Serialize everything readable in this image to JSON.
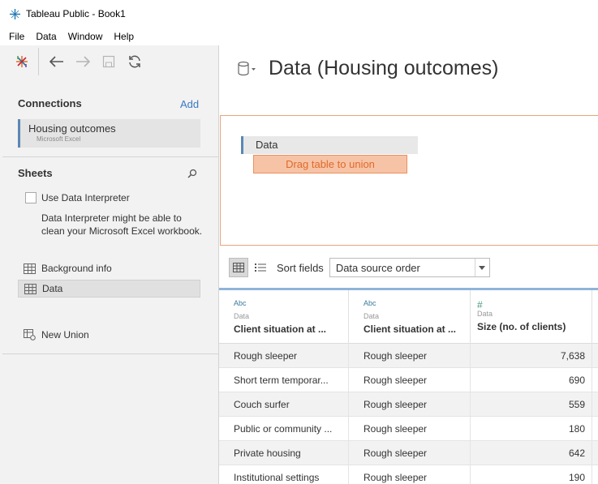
{
  "window": {
    "title": "Tableau Public - Book1"
  },
  "menu": [
    "File",
    "Data",
    "Window",
    "Help"
  ],
  "left": {
    "connections_title": "Connections",
    "add_label": "Add",
    "connection": {
      "name": "Housing outcomes",
      "type": "Microsoft Excel"
    },
    "sheets_title": "Sheets",
    "use_interpreter_label": "Use Data Interpreter",
    "interpreter_desc": "Data Interpreter might be able to clean your Microsoft Excel workbook.",
    "sheets": [
      {
        "label": "Background info",
        "selected": false
      },
      {
        "label": "Data",
        "selected": true
      }
    ],
    "new_union_label": "New Union"
  },
  "right": {
    "title": "Data (Housing outcomes)",
    "canvas": {
      "table_label": "Data",
      "drop_hint": "Drag table to union"
    },
    "sort_label": "Sort fields",
    "sort_value": "Data source order",
    "columns": [
      {
        "type": "Abc",
        "source": "Data",
        "name": "Client situation at ..."
      },
      {
        "type": "Abc",
        "source": "Data",
        "name": "Client situation at ..."
      },
      {
        "type": "#",
        "source": "Data",
        "name": "Size (no. of clients)"
      }
    ],
    "rows": [
      [
        "Rough sleeper",
        "Rough sleeper",
        "7,638"
      ],
      [
        "Short term temporar...",
        "Rough sleeper",
        "690"
      ],
      [
        "Couch surfer",
        "Rough sleeper",
        "559"
      ],
      [
        "Public or community ...",
        "Rough sleeper",
        "180"
      ],
      [
        "Private housing",
        "Rough sleeper",
        "642"
      ],
      [
        "Institutional settings",
        "Rough sleeper",
        "190"
      ]
    ]
  },
  "colors": {
    "accent_blue": "#5b87b5",
    "drop_orange": "#e06a2a",
    "link": "#3a78c4"
  }
}
